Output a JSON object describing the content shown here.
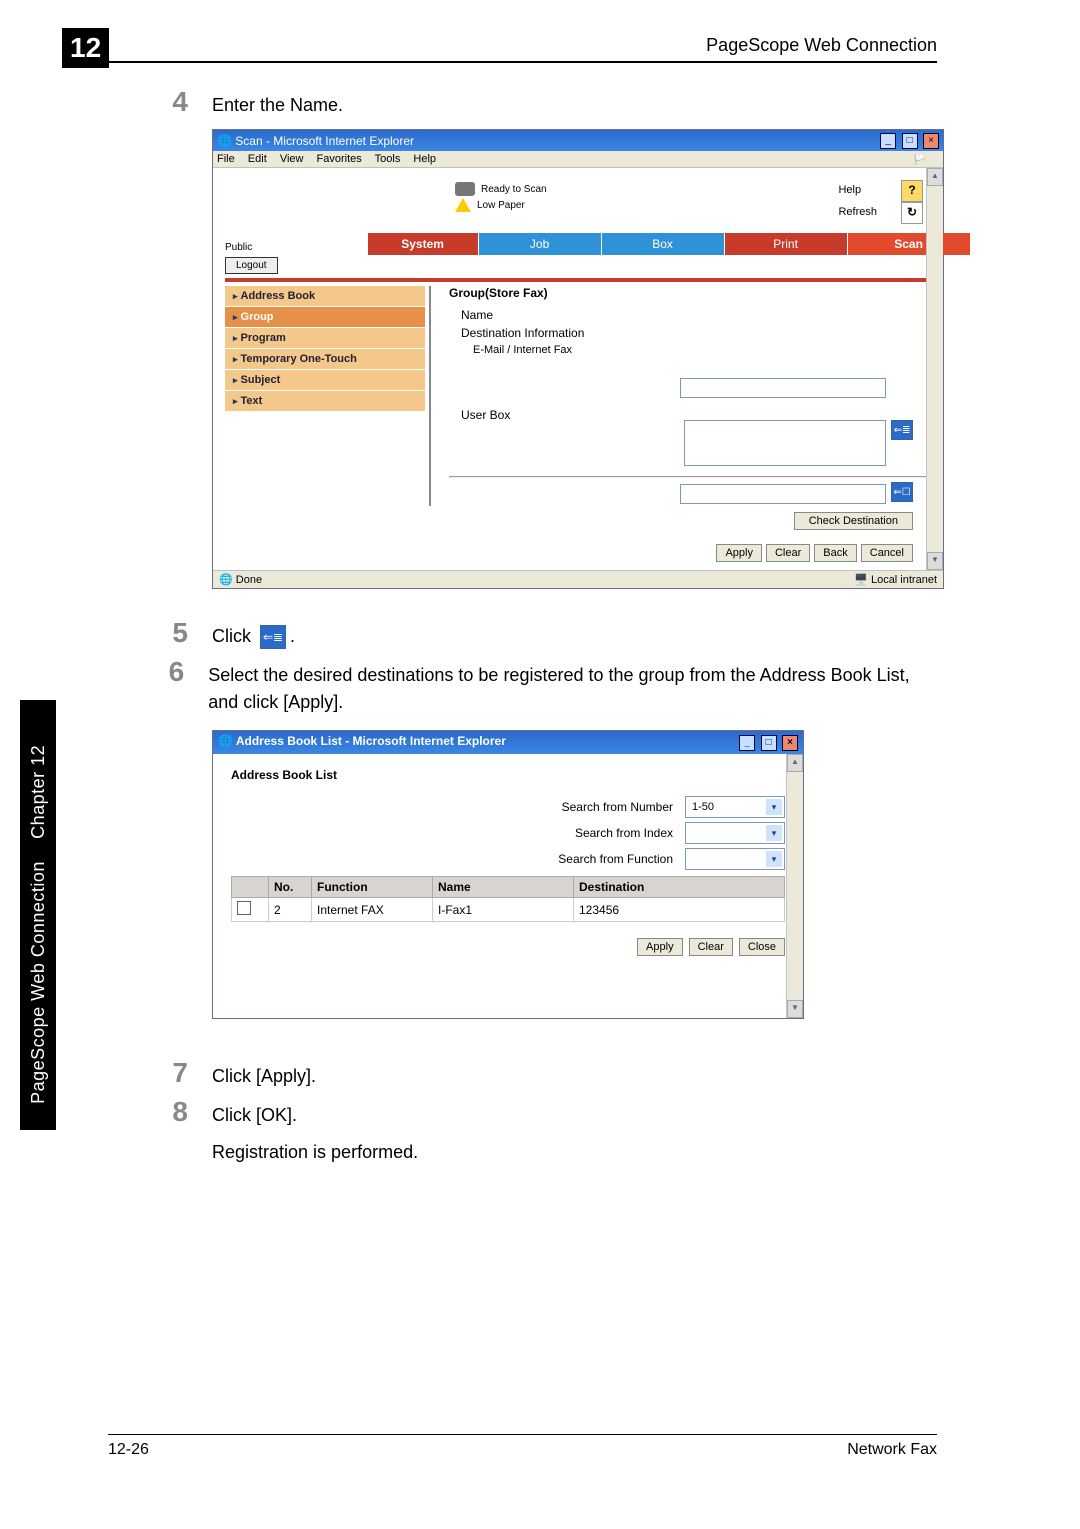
{
  "header": {
    "chapter_number": "12",
    "title": "PageScope Web Connection"
  },
  "steps": {
    "s4": {
      "num": "4",
      "text": "Enter the Name."
    },
    "s5": {
      "num": "5",
      "text_before": "Click ",
      "text_after": "."
    },
    "s6": {
      "num": "6",
      "text": "Select the desired destinations to be registered to the group from the Address Book List, and click [Apply]."
    },
    "s7": {
      "num": "7",
      "text": "Click [Apply]."
    },
    "s8": {
      "num": "8",
      "text": "Click [OK].",
      "text2": "Registration is performed."
    }
  },
  "ie1": {
    "window_title": "Scan - Microsoft Internet Explorer",
    "menu": [
      "File",
      "Edit",
      "View",
      "Favorites",
      "Tools",
      "Help"
    ],
    "status": {
      "ready": "Ready to Scan",
      "low": "Low Paper"
    },
    "links": {
      "help": "Help",
      "refresh": "Refresh"
    },
    "public": "Public",
    "logout": "Logout",
    "tabs": {
      "system": "System",
      "job": "Job",
      "box": "Box",
      "print": "Print",
      "scan": "Scan"
    },
    "side": [
      "Address Book",
      "Group",
      "Program",
      "Temporary One-Touch",
      "Subject",
      "Text"
    ],
    "panel": {
      "title": "Group(Store Fax)",
      "name": "Name",
      "dest_info": "Destination Information",
      "email_ifax": "E-Mail / Internet Fax",
      "user_box": "User Box",
      "check": "Check Destination",
      "apply": "Apply",
      "clear": "Clear",
      "back": "Back",
      "cancel": "Cancel"
    },
    "statusbar": {
      "done": "Done",
      "zone": "Local intranet"
    }
  },
  "ie2": {
    "window_title": "Address Book List - Microsoft Internet Explorer",
    "title": "Address Book List",
    "search": {
      "num_label": "Search from Number",
      "num_value": "1-50",
      "idx_label": "Search from Index",
      "fun_label": "Search from Function"
    },
    "cols": {
      "no": "No.",
      "function": "Function",
      "name": "Name",
      "dest": "Destination"
    },
    "row": {
      "no": "2",
      "function": "Internet FAX",
      "name": "I-Fax1",
      "dest": "123456"
    },
    "btns": {
      "apply": "Apply",
      "clear": "Clear",
      "close": "Close"
    }
  },
  "side_tab": {
    "main": "PageScope Web Connection",
    "chapter": "Chapter 12"
  },
  "footer": {
    "page": "12-26",
    "product": "Network Fax"
  },
  "chart_data": null
}
